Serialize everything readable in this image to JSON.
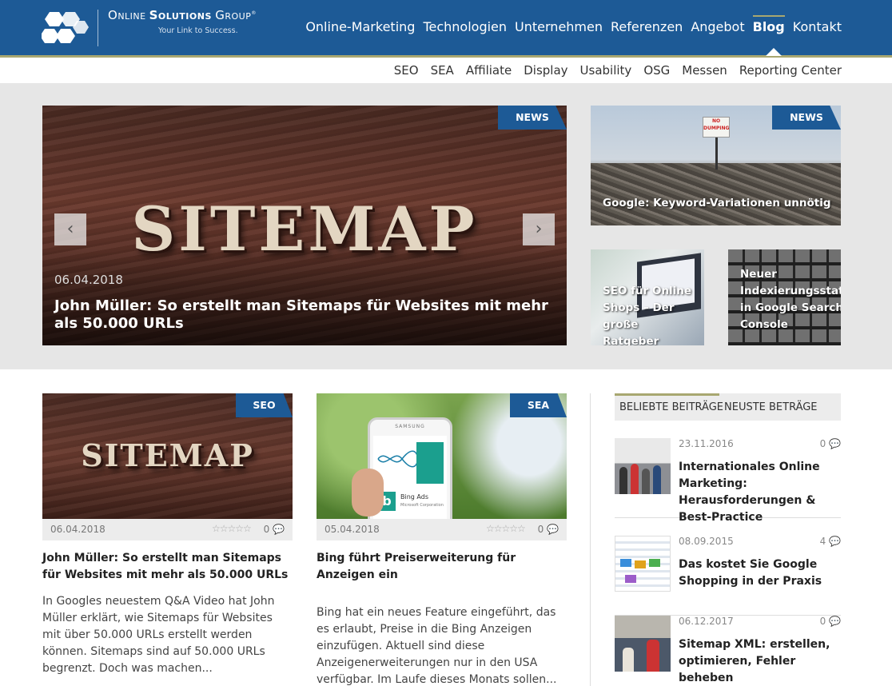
{
  "brand": {
    "name": "Online Solutions Group",
    "name_parts": [
      "O",
      "NLINE ",
      "S",
      "OLUTIONS ",
      "G",
      "ROUP"
    ],
    "tagline": "Your Link to Success."
  },
  "main_nav": [
    "Online-Marketing",
    "Technologien",
    "Unternehmen",
    "Referenzen",
    "Angebot",
    "Blog",
    "Kontakt"
  ],
  "main_nav_active": "Blog",
  "sub_nav": [
    "SEO",
    "SEA",
    "Affiliate",
    "Display",
    "Usability",
    "OSG",
    "Messen",
    "Reporting Center"
  ],
  "slider": {
    "badge": "NEWS",
    "image_text": "SITEMAP",
    "date": "06.04.2018",
    "title": "John Müller: So erstellt man Sitemaps für Websites mit mehr als 50.000 URLs",
    "prev": "‹",
    "next": "›"
  },
  "tiles": [
    {
      "badge": "NEWS",
      "sign_text": "NO DUMPING",
      "title": "Google: Keyword-Variationen unnötig"
    },
    {
      "title": "SEO für Online Shops – Der große Ratgeber"
    },
    {
      "title": "Neuer Indexierungsstatus in Google Search Console"
    }
  ],
  "cards": [
    {
      "badge": "SEO",
      "image_text": "SITEMAP",
      "date": "06.04.2018",
      "stars": "☆☆☆☆☆",
      "comments": "0 💬",
      "title": "John Müller: So erstellt man Sitemaps für Websites mit mehr als 50.000 URLs",
      "text": "In Googles neuestem Q&A Video hat John Müller erklärt, wie Sitemaps für Websites mit über 50.000 URLs erstellt werden können. Sitemaps sind auf 50.000 URLs begrenzt. Doch was machen..."
    },
    {
      "badge": "SEA",
      "phone_brand": "SAMSUNG",
      "app_label": "Bing Ads",
      "app_sub": "Microsoft Corporation",
      "date": "05.04.2018",
      "stars": "☆☆☆☆☆",
      "comments": "0 💬",
      "title": "Bing führt Preiserweiterung für Anzeigen ein",
      "text": "Bing hat ein neues Feature eingeführt, das es erlaubt, Preise in die Bing Anzeigen einzufügen. Aktuell sind diese Anzeigenerweiterungen nur in den USA verfügbar. Im Laufe dieses Monats sollen..."
    }
  ],
  "sidebar": {
    "tabs": [
      "BELIEBTE BEITRÄGE",
      "NEUSTE BETRÄGE"
    ],
    "active_tab": "BELIEBTE BEITRÄGE",
    "posts": [
      {
        "date": "23.11.2016",
        "comments": "0 💬",
        "title": "Internationales Online Marketing: Herausforderungen & Best-Practice"
      },
      {
        "date": "08.09.2015",
        "comments": "4 💬",
        "title": "Das kostet Sie Google Shopping in der Praxis"
      },
      {
        "date": "06.12.2017",
        "comments": "0 💬",
        "title": "Sitemap XML: erstellen, optimieren, Fehler beheben"
      }
    ]
  },
  "colors": {
    "brand_blue": "#1d5a96",
    "accent": "#a8a770",
    "band_gray": "#e6e6e6"
  }
}
